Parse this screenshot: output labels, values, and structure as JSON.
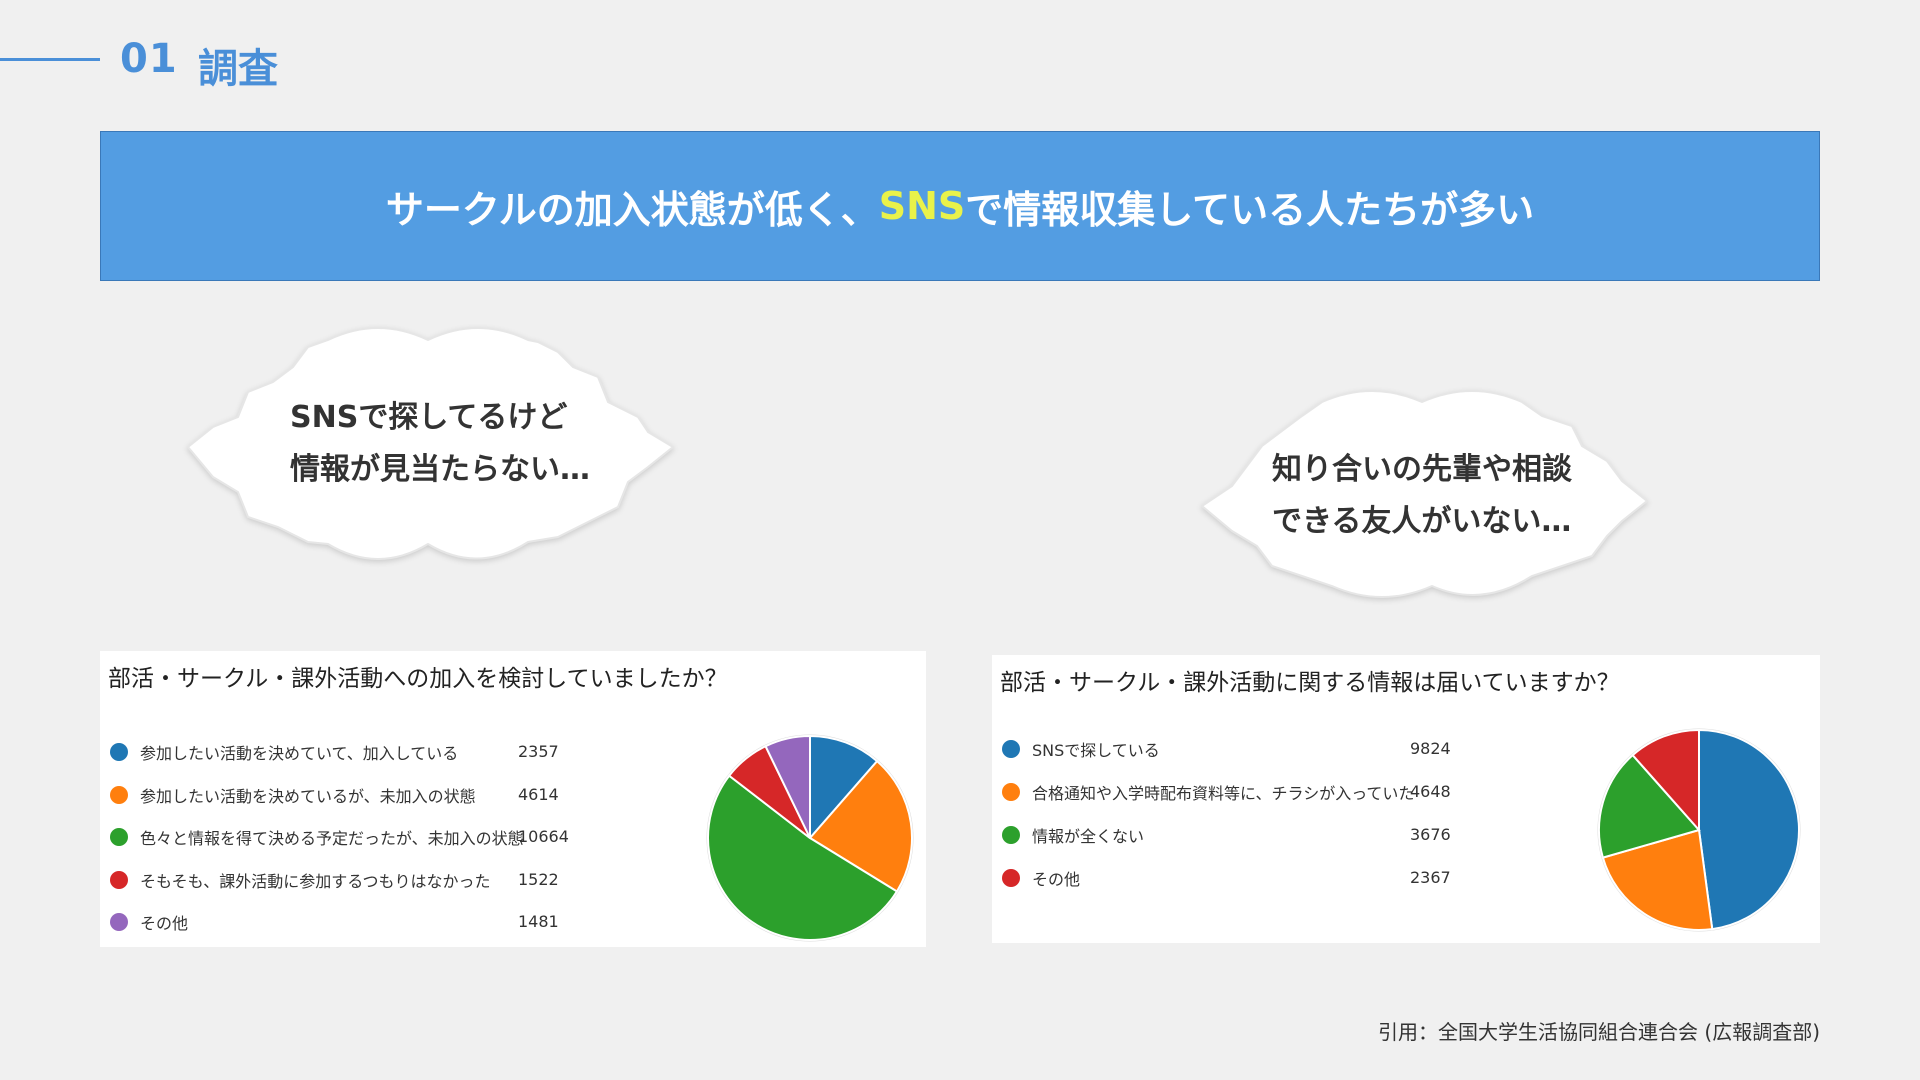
{
  "header": {
    "number": "01",
    "title": "調査"
  },
  "banner": {
    "text_before": "サークルの加入状態が低く、",
    "highlight": "SNS",
    "text_after": "で情報収集している人たちが多い"
  },
  "bubbles": [
    {
      "line1": "SNSで探してるけど",
      "line2": "情報が見当たらない…"
    },
    {
      "line1": "知り合いの先輩や相談",
      "line2": "できる友人がいない…"
    }
  ],
  "chart_data": [
    {
      "type": "pie",
      "title": "部活・サークル・課外活動への加入を検討していましたか？",
      "categories": [
        " 参加したい活動を決めていて、加入している",
        "参加したい活動を決めているが、未加入の状態",
        "色々と情報を得て決める予定だったが、未加入の状態",
        "そもそも、課外活動に参加するつもりはなかった",
        "その他"
      ],
      "values": [
        2357,
        4614,
        10664,
        1522,
        1481
      ],
      "colors": [
        "#1f77b4",
        "#ff7f0e",
        "#2ca02c",
        "#d62728",
        "#9467bd"
      ]
    },
    {
      "type": "pie",
      "title": "部活・サークル・課外活動に関する情報は届いていますか？",
      "categories": [
        "SNSで探している",
        "合格通知や入学時配布資料等に、チラシが入っていた",
        "情報が全くない",
        "その他"
      ],
      "values": [
        9824,
        4648,
        3676,
        2367
      ],
      "colors": [
        "#1f77b4",
        "#ff7f0e",
        "#2ca02c",
        "#d62728"
      ]
    }
  ],
  "citation": "引用：全国大学生活協同組合連合会 (広報調査部)"
}
